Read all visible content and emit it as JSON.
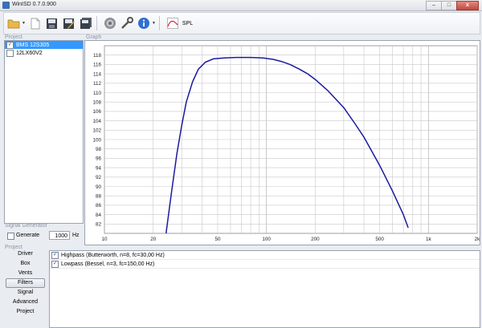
{
  "window": {
    "title": "WinISD 0.7.0.900",
    "min_glyph": "–",
    "max_glyph": "□",
    "close_glyph": "x"
  },
  "toolbar": {
    "icons": [
      "open-folder-icon",
      "new-document-icon",
      "save-icon",
      "save-as-icon",
      "save-all-icon",
      "driver-icon",
      "wrench-icon",
      "info-icon",
      "spl-chart-icon"
    ],
    "spl_label": "SPL"
  },
  "sections": {
    "project": "Project",
    "graph": "Graph",
    "signal_generator": "Signal Generator",
    "project_bottom": "Project"
  },
  "projects": [
    {
      "name": "BMS 12S305",
      "checked": true,
      "selected": true
    },
    {
      "name": "12LX60V2",
      "checked": false,
      "selected": false
    }
  ],
  "signal_generator": {
    "generate_label": "Generate",
    "generate_checked": false,
    "frequency": "1000",
    "unit": "Hz"
  },
  "nav_tabs": [
    "Driver",
    "Box",
    "Vents",
    "Filters",
    "Signal",
    "Advanced",
    "Project"
  ],
  "active_tab": "Filters",
  "filters": [
    {
      "label": "Highpass (Butterworth, n=8, fc=30,00 Hz)",
      "checked": true
    },
    {
      "label": "Lowpass (Bessel, n=3, fc=150,00 Hz)",
      "checked": true
    }
  ],
  "chart_data": {
    "type": "line",
    "x_scale": "log",
    "xlim": [
      10,
      2000
    ],
    "ylim": [
      80,
      120
    ],
    "x_ticks": [
      10,
      20,
      50,
      100,
      200,
      500,
      1000,
      2000
    ],
    "x_tick_labels": [
      "10",
      "20",
      "50",
      "100",
      "200",
      "500",
      "1k",
      "2k"
    ],
    "y_ticks": [
      82,
      84,
      86,
      88,
      90,
      92,
      94,
      96,
      98,
      100,
      102,
      104,
      106,
      108,
      110,
      112,
      114,
      116,
      118
    ],
    "grid": true,
    "series": [
      {
        "color": "#1a1aa0",
        "x": [
          24,
          26,
          28,
          30,
          32,
          35,
          38,
          42,
          47,
          55,
          65,
          80,
          95,
          110,
          125,
          140,
          160,
          180,
          200,
          240,
          300,
          350,
          400,
          500,
          600,
          700,
          750
        ],
        "y": [
          80,
          89,
          97,
          103,
          108,
          112.3,
          115,
          116.5,
          117.2,
          117.4,
          117.5,
          117.5,
          117.4,
          117.1,
          116.6,
          116,
          115,
          114,
          112.8,
          110.4,
          106.8,
          103.5,
          100.5,
          94.5,
          89,
          84,
          81.2
        ]
      }
    ]
  },
  "colors": {
    "selected_row": "#3399ff",
    "curve": "#1a1aa0",
    "grid": "#c8c8c8",
    "section_label": "#8c95a6"
  }
}
